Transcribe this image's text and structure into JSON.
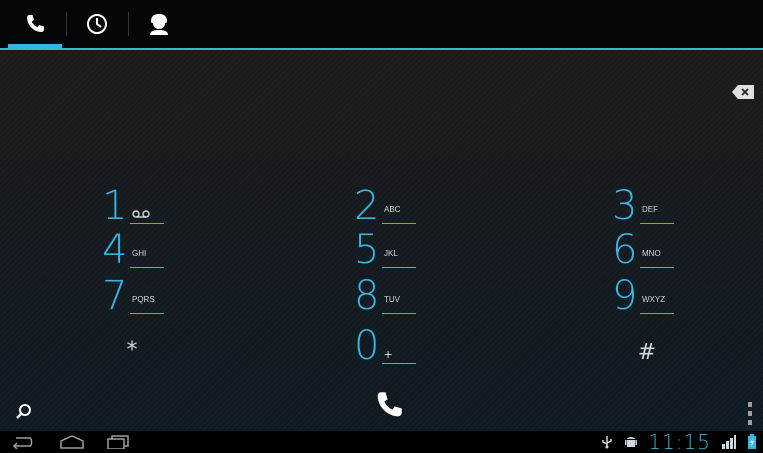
{
  "tabs": [
    {
      "name": "phone",
      "icon": "phone-icon",
      "active": true
    },
    {
      "name": "call-log",
      "icon": "clock-icon",
      "active": false
    },
    {
      "name": "contacts",
      "icon": "person-icon",
      "active": false
    }
  ],
  "keypad": {
    "keys": [
      {
        "digit": "1",
        "letters": ""
      },
      {
        "digit": "2",
        "letters": "ABC"
      },
      {
        "digit": "3",
        "letters": "DEF"
      },
      {
        "digit": "4",
        "letters": "GHI"
      },
      {
        "digit": "5",
        "letters": "JKL"
      },
      {
        "digit": "6",
        "letters": "MNO"
      },
      {
        "digit": "7",
        "letters": "PQRS"
      },
      {
        "digit": "8",
        "letters": "TUV"
      },
      {
        "digit": "9",
        "letters": "WXYZ"
      },
      {
        "digit": "0",
        "letters": "+"
      }
    ],
    "star": "*",
    "hash": "#"
  },
  "status": {
    "time": "11:15"
  },
  "colors": {
    "accent": "#33b5e5",
    "background": "#000000"
  }
}
